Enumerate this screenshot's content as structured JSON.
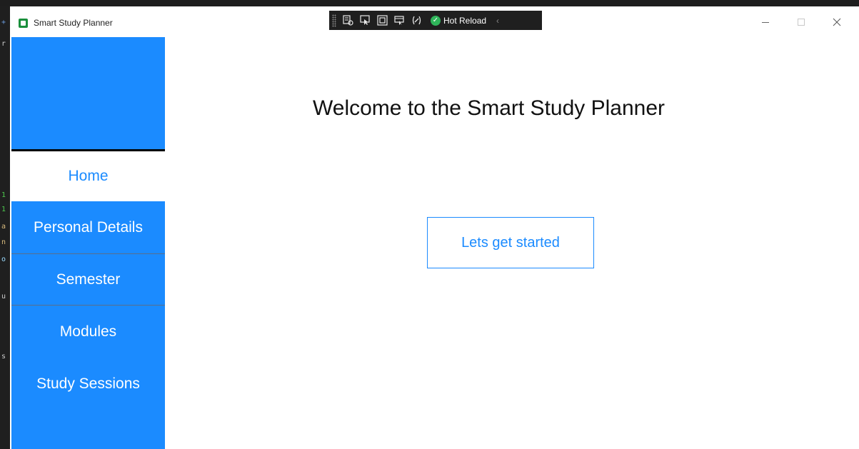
{
  "window": {
    "title": "Smart Study Planner"
  },
  "debug_toolbar": {
    "hot_reload_label": "Hot Reload"
  },
  "sidebar": {
    "items": [
      {
        "label": "Home",
        "active": true
      },
      {
        "label": "Personal Details",
        "active": false
      },
      {
        "label": "Semester",
        "active": false
      },
      {
        "label": "Modules",
        "active": false
      },
      {
        "label": "Study Sessions",
        "active": false
      }
    ]
  },
  "main": {
    "title": "Welcome to the Smart Study Planner",
    "start_button_label": "Lets get started"
  },
  "colors": {
    "accent": "#1b8bff",
    "debug_toolbar": "#1f1f1f",
    "hot_reload_ok": "#2fb45a"
  },
  "icons": {
    "app": "app-icon",
    "minimize": "minimize-icon",
    "maximize": "maximize-icon",
    "close": "close-icon"
  }
}
